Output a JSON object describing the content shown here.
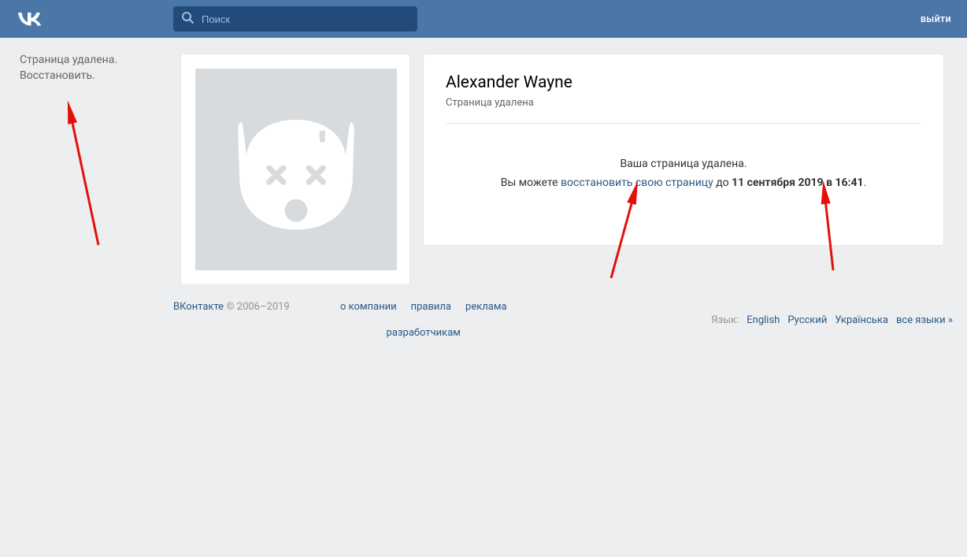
{
  "header": {
    "search_placeholder": "Поиск",
    "logout": "выйти"
  },
  "sidebar": {
    "deleted_text": "Страница удалена.",
    "restore_link": "Восстановить."
  },
  "profile": {
    "name": "Alexander Wayne",
    "status": "Страница удалена",
    "deleted_heading": "Ваша страница удалена.",
    "restore_prefix": "Вы можете ",
    "restore_link": "восстановить свою страницу",
    "restore_until_word": " до ",
    "restore_deadline": "11 сентября 2019 в 16:41",
    "period": "."
  },
  "footer": {
    "brand": "ВКонтакте",
    "copyright": " © 2006–2019",
    "links": {
      "about": "о компании",
      "rules": "правила",
      "ads": "реклама",
      "devs": "разработчикам"
    },
    "lang_label": "Язык:",
    "langs": {
      "en": "English",
      "ru": "Русский",
      "ua": "Українська",
      "all": "все языки »"
    }
  }
}
